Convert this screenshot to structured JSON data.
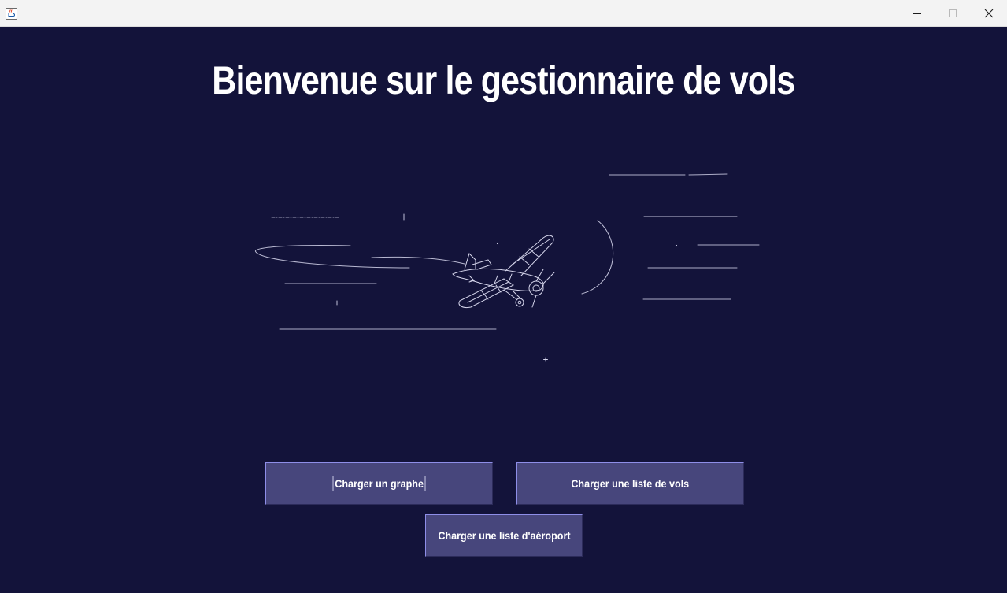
{
  "window": {
    "title": "",
    "controls": {
      "minimize": "minimize-icon",
      "maximize": "maximize-icon",
      "close": "close-icon"
    }
  },
  "main": {
    "heading": "Bienvenue sur le gestionnaire de vols",
    "illustration": "biplane-night-sky-illustration"
  },
  "buttons": {
    "load_graph": "Charger un graphe",
    "load_flights": "Charger une liste de vols",
    "load_airports": "Charger une liste d'aéroport"
  },
  "colors": {
    "background": "#13133a",
    "button": "#47467c",
    "button_border": "#8e8ee8",
    "text": "#ffffff",
    "titlebar": "#f3f3f3"
  }
}
